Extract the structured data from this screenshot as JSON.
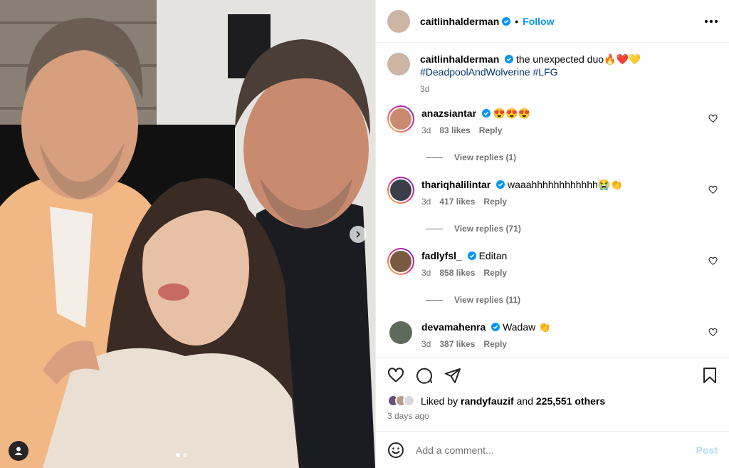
{
  "post": {
    "author": "caitlinhalderman",
    "follow_label": "Follow",
    "separator": "•",
    "caption_text": "the unexpected duo",
    "caption_emoji": "🔥❤️💛",
    "hashtags": "#DeadpoolAndWolverine #LFG",
    "caption_age": "3d"
  },
  "comments": [
    {
      "user": "anazsiantar",
      "text": "😍😍😍",
      "age": "3d",
      "likes": "83 likes",
      "reply": "Reply",
      "view_replies": "View replies (1)",
      "avatar_color": "#c98a6f",
      "ring": true
    },
    {
      "user": "thariqhalilintar",
      "text": "waaahhhhhhhhhhhh😭👏",
      "age": "3d",
      "likes": "417 likes",
      "reply": "Reply",
      "view_replies": "View replies (71)",
      "avatar_color": "#3a3d4a",
      "ring": true
    },
    {
      "user": "fadlyfsl_",
      "text": "Editan",
      "age": "3d",
      "likes": "858 likes",
      "reply": "Reply",
      "view_replies": "View replies (11)",
      "avatar_color": "#7b5a44",
      "ring": true
    },
    {
      "user": "devamahenra",
      "text": "Wadaw 👏",
      "age": "3d",
      "likes": "387 likes",
      "reply": "Reply",
      "view_replies": "",
      "avatar_color": "#5f6b5a",
      "ring": false
    }
  ],
  "likes": {
    "prefix": "Liked by",
    "user": "randyfauzif",
    "and": "and",
    "others": "225,551 others"
  },
  "date": "3 days ago",
  "add_comment": {
    "placeholder": "Add a comment...",
    "post_label": "Post"
  },
  "colors": {
    "accent": "#0095f6",
    "hashtag": "#00376b",
    "muted": "#737373",
    "verified": "#0095f6"
  },
  "icons": [
    "heart-icon",
    "comment-icon",
    "share-icon",
    "bookmark-icon",
    "more-options-icon",
    "emoji-icon",
    "next-arrow-icon",
    "user-tag-icon",
    "verified-badge-icon"
  ]
}
